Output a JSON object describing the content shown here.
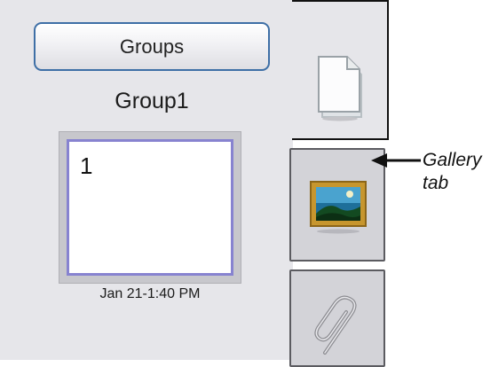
{
  "sidebar": {
    "groups_button_label": "Groups",
    "group_name": "Group1",
    "thumbnail": {
      "page_number": "1",
      "timestamp": "Jan 21-1:40 PM"
    }
  },
  "tabs": [
    {
      "icon": "page-icon"
    },
    {
      "icon": "gallery-icon"
    },
    {
      "icon": "paperclip-icon"
    }
  ],
  "annotation": {
    "label_line1": "Gallery",
    "label_line2": "tab"
  },
  "colors": {
    "panel_background": "#e6e6ea",
    "button_border": "#3e6fa6",
    "thumbnail_border": "#8783d0",
    "tab_background": "#d3d3d8"
  }
}
